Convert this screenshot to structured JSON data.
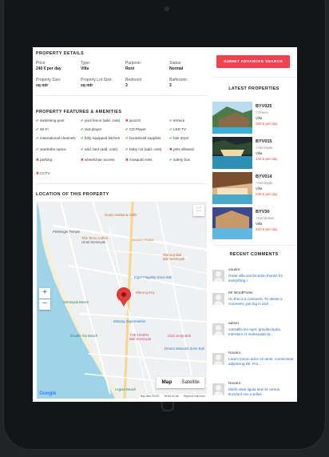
{
  "details": {
    "title": "PROPERTY DETAILS",
    "fields": [
      {
        "label": "Price:",
        "value": "240 € per day"
      },
      {
        "label": "Type:",
        "value": "Villa"
      },
      {
        "label": "Purpose:",
        "value": "Rent"
      },
      {
        "label": "Status:",
        "value": "Normal"
      },
      {
        "label": "Property Size:",
        "value": "sq mtr"
      },
      {
        "label": "Property Lot Size:",
        "value": "sq mtr"
      },
      {
        "label": "Bedroom:",
        "value": "3"
      },
      {
        "label": "Bathroom:",
        "value": "3"
      }
    ]
  },
  "features": {
    "title": "PROPERTY FEATURES & AMENITIES",
    "items": [
      {
        "label": "swimming pool",
        "available": true
      },
      {
        "label": "pool fence (add. cost)",
        "available": true
      },
      {
        "label": "jacuzzi",
        "available": false
      },
      {
        "label": "terrace",
        "available": true
      },
      {
        "label": "Wi-Fi",
        "available": true
      },
      {
        "label": "dvd player",
        "available": true
      },
      {
        "label": "CD Player",
        "available": true
      },
      {
        "label": "LED TV",
        "available": true
      },
      {
        "label": "international channels",
        "available": true
      },
      {
        "label": "fully equipped kitchen",
        "available": true
      },
      {
        "label": "household supplies",
        "available": true
      },
      {
        "label": "hair dryer",
        "available": true
      },
      {
        "label": "wardrobe space",
        "available": true
      },
      {
        "label": "add. bed (add. cost)",
        "available": true
      },
      {
        "label": "baby cot (add. cost)",
        "available": true
      },
      {
        "label": "pets allowed",
        "available": false
      },
      {
        "label": "parking",
        "available": false
      },
      {
        "label": "wheelchair access",
        "available": false
      },
      {
        "label": "mosquito nets",
        "available": false
      },
      {
        "label": "safety box",
        "available": true
      },
      {
        "label": "CCTV",
        "available": false
      }
    ]
  },
  "location": {
    "title": "LOCATION OF THIS PROPERTY",
    "map": {
      "labels": [
        "Gusto Gelato & Caffe",
        "Petitenget Temple",
        "Titik Temu Coffee",
        "Umai Seminyak",
        "Corner House",
        "Warung Bali",
        "Bali Seminyak",
        "Eiger Flagship Store Bali",
        "Warung Eny",
        "Seminyak Beach",
        "Bintang Supermarket",
        "THE HAVEN",
        "Bali Seminyak",
        "Club Jenja Bali",
        "Double Six Beach",
        "Dream Museum Zone Bali",
        "Legian Beach"
      ],
      "map_type_options": [
        "Map",
        "Satellite"
      ],
      "selected_map_type": "Map",
      "zoom_in": "+",
      "zoom_out": "−",
      "fullscreen_icon": "fullscreen-icon",
      "google_logo": "Google",
      "footer": [
        "Map data ©2022",
        "Terms of Use",
        "Report a map error"
      ]
    }
  },
  "sidebar": {
    "submit_label": "SUBMIT ADVANCED SEARCH",
    "latest_title": "LATEST PROPERTIES",
    "properties": [
      {
        "name": "BYV025",
        "location": "Oberoi",
        "type": "Villa",
        "price": "300 € per day"
      },
      {
        "name": "BYV015",
        "location": "Seminyak",
        "type": "Villa",
        "price": "240 € per day"
      },
      {
        "name": "BYV014",
        "location": "Seminyak",
        "type": "Villa",
        "price": "240 € per day"
      },
      {
        "name": "BYV30",
        "location": "Kerobokan",
        "type": "Villa",
        "price": "220 € per day"
      }
    ],
    "comments_title": "RECENT COMMENTS",
    "comments": [
      {
        "author": "vaudor",
        "excerpt": "Great villa and location thanks for everything !"
      },
      {
        "author": "Mr WordPress",
        "excerpt": "Hi, this is a comment. To delete a comment, just log in and ..."
      },
      {
        "author": "admin",
        "excerpt": "convallis leo eget, gravida ligula. Interdum et malesuada fa..."
      },
      {
        "author": "Novaro",
        "excerpt": "Lorem ipsum dolor sit amet, consectetur adipiscing elit. Pro..."
      },
      {
        "author": "Novaro",
        "excerpt": "Morbi vitae ligula sed mi cursus tincidunt nec a tellus"
      }
    ]
  },
  "colors": {
    "accent": "#f1404f",
    "price": "#e2483d",
    "check": "#3aa14a",
    "cross": "#e0403f",
    "link": "#2b6cb0",
    "device": "#141516",
    "background": "#232426"
  }
}
